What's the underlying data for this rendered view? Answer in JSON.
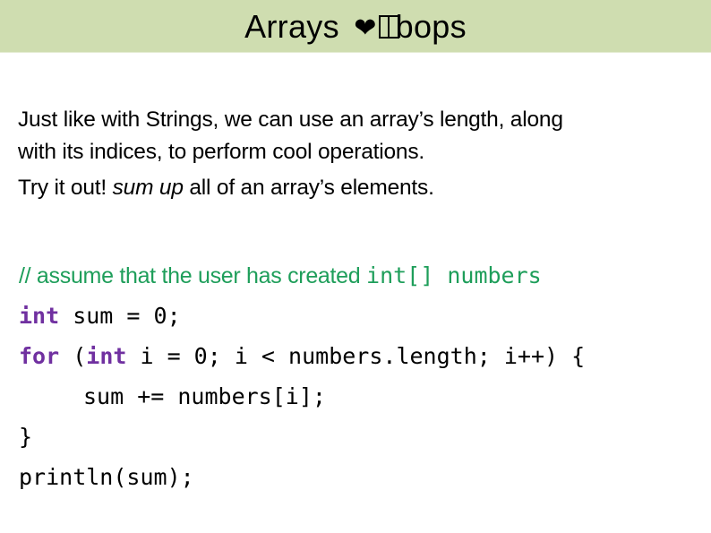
{
  "slide": {
    "title": {
      "before": "Arrays",
      "heart": "❤",
      "after": "bops"
    },
    "colors": {
      "title_bar": "#cfddb0",
      "comment": "#1e9e5a",
      "keyword": "#7030a0",
      "text": "#000000"
    },
    "body": {
      "line1": "Just like with Strings, we can use an array’s length, along",
      "line2": "with its indices, to perform cool operations.",
      "line3_prefix": "Try it out! ",
      "line3_emphasis": "sum up",
      "line3_suffix": " all of an array’s elements."
    },
    "code": {
      "comment_text": "// assume that the user has created ",
      "comment_code": "int[] numbers",
      "line2_kw": "int",
      "line2_rest": " sum = 0;",
      "line3_kw1": "for",
      "line3_mid": " (",
      "line3_kw2": "int",
      "line3_rest": " i = 0; i < numbers.length; i++) {",
      "line4": "sum += numbers[i];",
      "line5": "}",
      "line6": "println(sum);"
    }
  }
}
